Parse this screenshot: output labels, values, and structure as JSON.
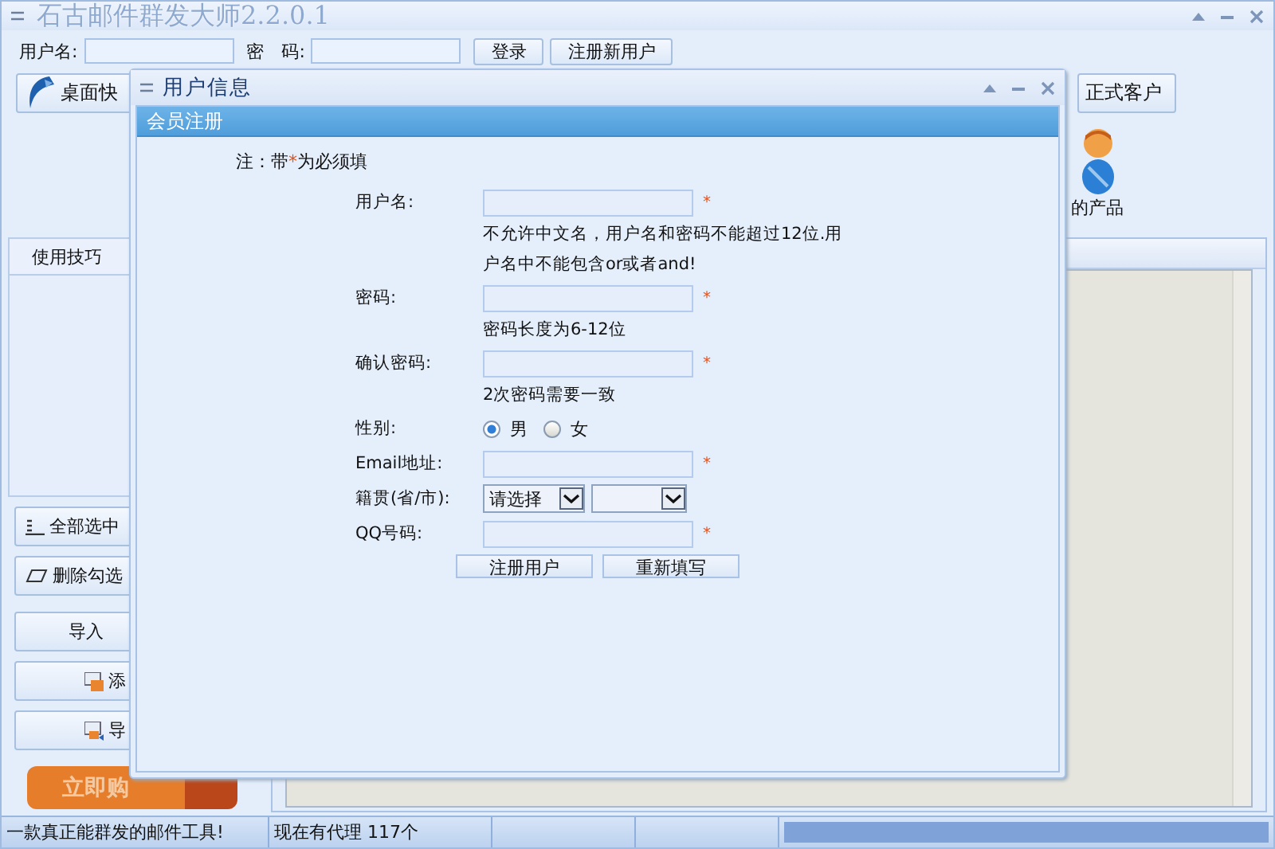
{
  "window": {
    "title": "石古邮件群发大师2.2.0.1"
  },
  "login": {
    "username_label": "用户名:",
    "password_label": "密　码:",
    "buttons": [
      "登录",
      "注册新用户"
    ]
  },
  "toolbar": {
    "left_button": "桌面快",
    "right_button": "正式客户"
  },
  "progress": {
    "level": 1
  },
  "product_label": "的产品",
  "sidebar": {
    "tab": "使用技巧",
    "buttons": [
      {
        "label": "全部选中",
        "kind": "select-all"
      },
      {
        "label": "删除勾选",
        "kind": "erase"
      },
      {
        "label": "导入",
        "kind": "plain"
      },
      {
        "label": "添",
        "kind": "add"
      },
      {
        "label": "导",
        "kind": "export"
      }
    ],
    "buy_button": "立即购"
  },
  "status_bar": [
    "一款真正能群发的邮件工具!",
    "现在有代理 117个"
  ],
  "dialog": {
    "title": "用户信息",
    "section": "会员注册",
    "required_mark": "*",
    "note": {
      "before": "注：带",
      "after": "为必须填"
    },
    "rows": [
      {
        "kind": "input",
        "label": "用户名:",
        "required": true
      },
      {
        "kind": "hint",
        "text": "不允许中文名，用户名和密码不能超过12位.用户名中不能包含or或者and!"
      },
      {
        "kind": "input",
        "label": "密码:",
        "required": true
      },
      {
        "kind": "hint",
        "text": "密码长度为6-12位"
      },
      {
        "kind": "input",
        "label": "确认密码:",
        "required": true
      },
      {
        "kind": "hint",
        "text": "2次密码需要一致"
      },
      {
        "kind": "radio",
        "label": "性别:",
        "options": [
          {
            "label": "男",
            "selected": true
          },
          {
            "label": "女",
            "selected": false
          }
        ]
      },
      {
        "kind": "input",
        "label": "Email地址:",
        "required": true
      },
      {
        "kind": "select",
        "label": "籍贯(省/市):",
        "value": "请选择"
      },
      {
        "kind": "input",
        "label": "QQ号码:",
        "required": true
      }
    ],
    "buttons": [
      "注册用户",
      "重新填写"
    ]
  }
}
